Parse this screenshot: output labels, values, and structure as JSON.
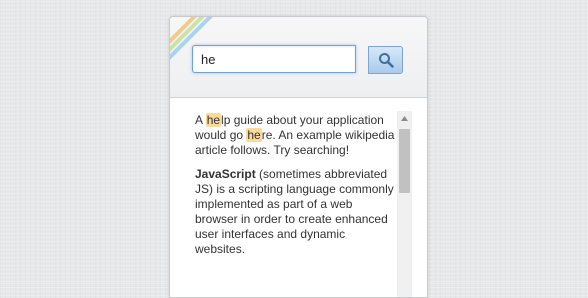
{
  "search": {
    "value": "he",
    "button_icon": "magnifier-icon"
  },
  "content": {
    "paragraph1": {
      "seg1": "A ",
      "hl1": "he",
      "seg2": "lp guide about your application would go ",
      "hl2": "he",
      "seg3": "re. An example wikipedia article follows. Try searching!"
    },
    "paragraph2": {
      "bold": "JavaScript",
      "rest": " (sometimes abbreviated JS) is a scripting language commonly implemented as part of a web browser in order to create enhanced user interfaces and dynamic websites."
    }
  },
  "colors": {
    "highlight": "#fbd99a",
    "input_border": "#6fa3d6",
    "button_bg": "#bcd8f1",
    "stripe_orange": "#f4c98c",
    "stripe_green": "#c9e3a8",
    "stripe_blue": "#a9d3ee"
  }
}
